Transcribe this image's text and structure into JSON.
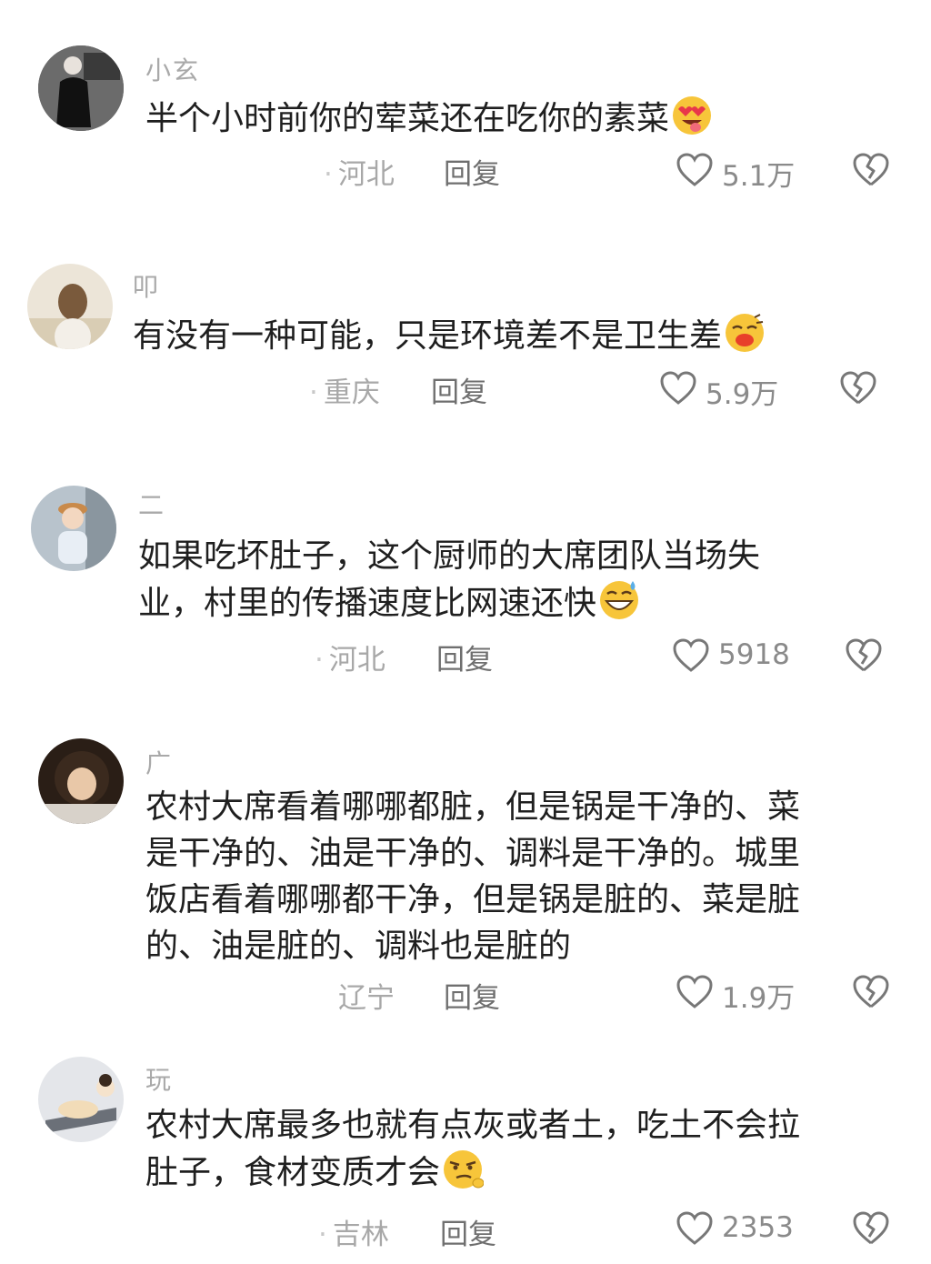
{
  "comments": [
    {
      "username": "小玄",
      "lines": [
        "半个小时前你的荤菜还在吃你的素菜"
      ],
      "emoji": "heart-eyes-tongue-emoji",
      "location": "河北",
      "reply_label": "回复",
      "likes": "5.1万"
    },
    {
      "username": "叩",
      "lines": [
        "有没有一种可能，只是环境差不是卫生差"
      ],
      "emoji": "kissing-closed-eyes-emoji",
      "location": "重庆",
      "reply_label": "回复",
      "likes": "5.9万"
    },
    {
      "username": "二",
      "lines": [
        "如果吃坏肚子，这个厨师的大席团队当场失",
        "业，村里的传播速度比网速还快"
      ],
      "emoji": "grinning-sweat-emoji",
      "location": "河北",
      "reply_label": "回复",
      "likes": "5918"
    },
    {
      "username": "广",
      "lines": [
        "农村大席看着哪哪都脏，但是锅是干净的、菜",
        "是干净的、油是干净的、调料是干净的。城里",
        "饭店看着哪哪都干净，但是锅是脏的、菜是脏",
        "的、油是脏的、调料也是脏的"
      ],
      "emoji": "",
      "location": "辽宁",
      "reply_label": "回复",
      "likes": "1.9万"
    },
    {
      "username": "玩",
      "lines": [
        "农村大席最多也就有点灰或者土，吃土不会拉",
        "肚子，食材变质才会"
      ],
      "emoji": "smirk-face-emoji",
      "location": "吉林",
      "reply_label": "回复",
      "likes": "2353"
    }
  ]
}
